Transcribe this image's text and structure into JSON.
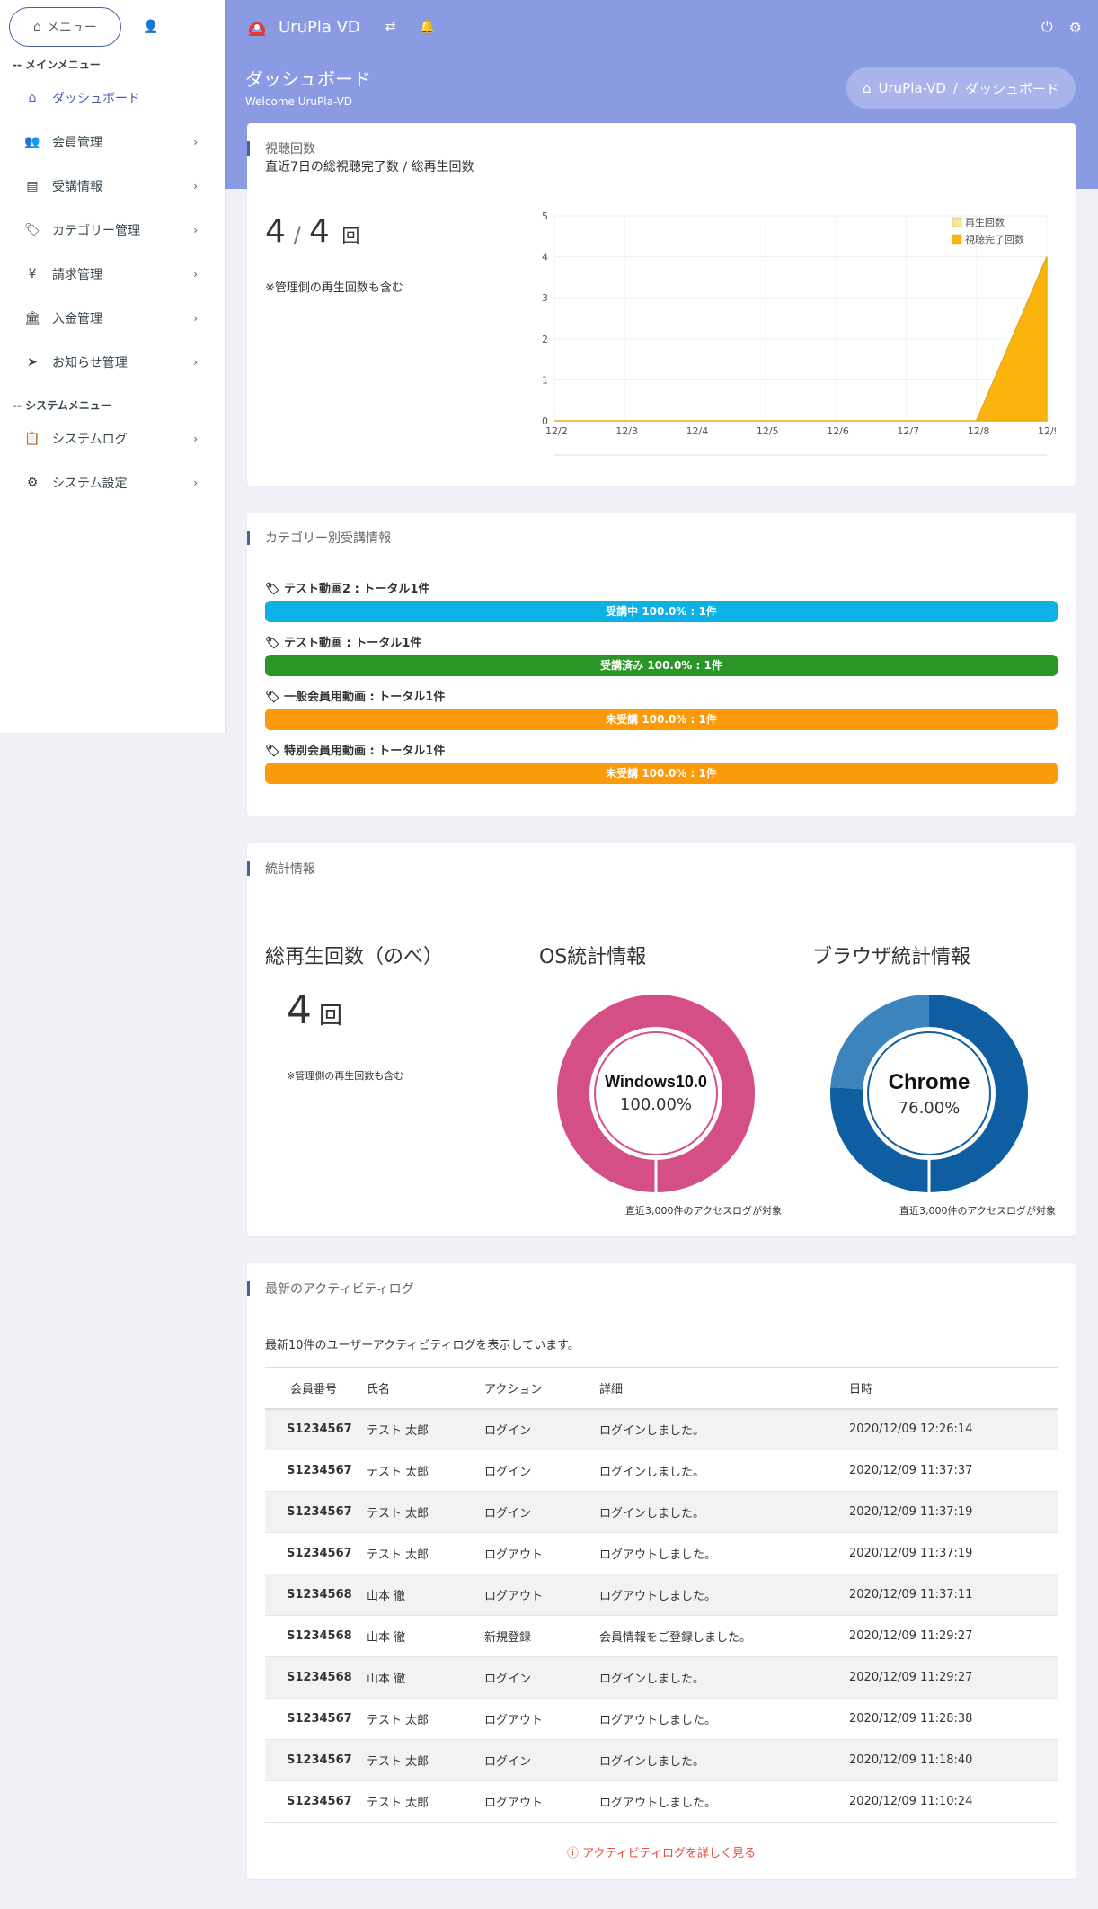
{
  "sidebar": {
    "menu_button": "メニュー",
    "main_heading": "-- メインメニュー",
    "system_heading": "-- システムメニュー",
    "items": [
      {
        "label": "ダッシュボード",
        "icon": "⌂",
        "active": true,
        "chevron": ""
      },
      {
        "label": "会員管理",
        "icon": "👥",
        "chevron": "›"
      },
      {
        "label": "受講情報",
        "icon": "▤",
        "chevron": "›"
      },
      {
        "label": "カテゴリー管理",
        "icon": "🏷",
        "chevron": "›"
      },
      {
        "label": "請求管理",
        "icon": "¥",
        "chevron": "›"
      },
      {
        "label": "入金管理",
        "icon": "🏛",
        "chevron": "›"
      },
      {
        "label": "お知らせ管理",
        "icon": "➤",
        "chevron": "›"
      }
    ],
    "system_items": [
      {
        "label": "システムログ",
        "icon": "📋",
        "chevron": "›"
      },
      {
        "label": "システム設定",
        "icon": "⚙",
        "chevron": "›"
      }
    ]
  },
  "topbar": {
    "app_title": "UruPla VD"
  },
  "header": {
    "page_title": "ダッシュボード",
    "welcome": "Welcome UruPla-VD",
    "breadcrumb_home": "UruPla-VD",
    "breadcrumb_sep": "/",
    "breadcrumb_current": "ダッシュボード"
  },
  "views": {
    "title": "視聴回数",
    "subtitle": "直近7日の総視聴完了数 / 総再生回数",
    "completed": "4",
    "sep": "/",
    "total": "4",
    "unit": "回",
    "note": "※管理側の再生回数も含む"
  },
  "chart_data": {
    "type": "area",
    "x": [
      "12/2",
      "12/3",
      "12/4",
      "12/5",
      "12/6",
      "12/7",
      "12/8",
      "12/9"
    ],
    "ylim": [
      0,
      5
    ],
    "yticks": [
      "0",
      "1",
      "2",
      "3",
      "4",
      "5"
    ],
    "legend": "top-right",
    "series": [
      {
        "name": "再生回数",
        "values": [
          0,
          0,
          0,
          0,
          0,
          0,
          0,
          4
        ],
        "color": "#f5e3a8"
      },
      {
        "name": "視聴完了回数",
        "values": [
          0,
          0,
          0,
          0,
          0,
          0,
          0,
          4
        ],
        "color": "#fbb40e"
      }
    ]
  },
  "category": {
    "title": "カテゴリー別受講情報",
    "items": [
      {
        "label": "テスト動画2 : トータル1件",
        "bar": "受講中 100.0% : 1件",
        "color": "#0eb1e3"
      },
      {
        "label": "テスト動画 : トータル1件",
        "bar": "受講済み 100.0% : 1件",
        "color": "#2b9527"
      },
      {
        "label": "一般会員用動画 : トータル1件",
        "bar": "未受講 100.0% : 1件",
        "color": "#fb9a0a"
      },
      {
        "label": "特別会員用動画 : トータル1件",
        "bar": "未受講 100.0% : 1件",
        "color": "#fb9a0a"
      }
    ]
  },
  "stats": {
    "title": "統計情報",
    "total_heading": "総再生回数（のべ）",
    "total_value": "4",
    "total_unit": "回",
    "total_note": "※管理側の再生回数も含む",
    "os_heading": "OS統計情報",
    "os_name": "Windows10.0",
    "os_pct": "100.00%",
    "os_share": 100,
    "os_color": "#d44f86",
    "os_note": "直近3,000件のアクセスログが対象",
    "browser_heading": "ブラウザ統計情報",
    "browser_name": "Chrome",
    "browser_pct": "76.00%",
    "browser_share": 76,
    "browser_color": "#0f5ea2",
    "browser_color2": "#3b84be",
    "browser_note": "直近3,000件のアクセスログが対象"
  },
  "activity": {
    "title": "最新のアクティビティログ",
    "intro": "最新10件のユーザーアクティビティログを表示しています。",
    "columns": [
      "会員番号",
      "氏名",
      "アクション",
      "詳細",
      "日時"
    ],
    "rows": [
      [
        "S1234567",
        "テスト 太郎",
        "ログイン",
        "ログインしました。",
        "2020/12/09 12:26:14"
      ],
      [
        "S1234567",
        "テスト 太郎",
        "ログイン",
        "ログインしました。",
        "2020/12/09 11:37:37"
      ],
      [
        "S1234567",
        "テスト 太郎",
        "ログイン",
        "ログインしました。",
        "2020/12/09 11:37:19"
      ],
      [
        "S1234567",
        "テスト 太郎",
        "ログアウト",
        "ログアウトしました。",
        "2020/12/09 11:37:19"
      ],
      [
        "S1234568",
        "山本 徹",
        "ログアウト",
        "ログアウトしました。",
        "2020/12/09 11:37:11"
      ],
      [
        "S1234568",
        "山本 徹",
        "新規登録",
        "会員情報をご登録しました。",
        "2020/12/09 11:29:27"
      ],
      [
        "S1234568",
        "山本 徹",
        "ログイン",
        "ログインしました。",
        "2020/12/09 11:29:27"
      ],
      [
        "S1234567",
        "テスト 太郎",
        "ログアウト",
        "ログアウトしました。",
        "2020/12/09 11:28:38"
      ],
      [
        "S1234567",
        "テスト 太郎",
        "ログイン",
        "ログインしました。",
        "2020/12/09 11:18:40"
      ],
      [
        "S1234567",
        "テスト 太郎",
        "ログアウト",
        "ログアウトしました。",
        "2020/12/09 11:10:24"
      ]
    ],
    "more_link": "アクティビティログを詳しく見る"
  }
}
